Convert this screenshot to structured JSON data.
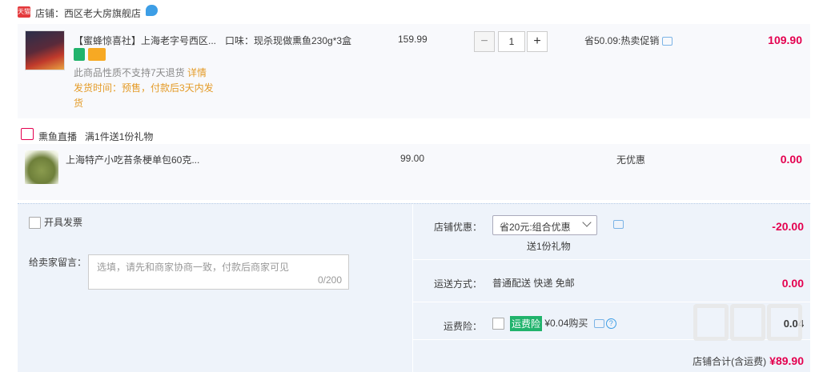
{
  "shop": {
    "badge": "天猫",
    "label": "店铺：",
    "name": "西区老大房旗舰店"
  },
  "item1": {
    "title": "【蜜蜂惊喜社】上海老字号西区...",
    "sku": "口味：现杀现做熏鱼230g*3盒",
    "note_prefix": "此商品性质不支持7天退货",
    "note_link": "详情",
    "ship_time": "发货时间：预售，付款后3天内发货",
    "price": "159.99",
    "qty": "1",
    "qty_minus": "−",
    "qty_plus": "+",
    "promo": "省50.09:热卖促销",
    "total": "109.90"
  },
  "gift": {
    "label": "熏鱼直播",
    "rule": "满1件送1份礼物"
  },
  "item2": {
    "title": "上海特产小吃苔条梗单包60克...",
    "price": "99.00",
    "promo": "无优惠",
    "total": "0.00"
  },
  "bottom": {
    "invoice_label": "开具发票",
    "msg_label": "给卖家留言：",
    "msg_placeholder": "选填，请先和商家协商一致，付款后商家可见",
    "msg_count": "0/200",
    "discount_label": "店铺优惠：",
    "discount_select": "省20元:组合优惠",
    "discount_gift": "送1份礼物",
    "discount_value": "-20.00",
    "ship_label": "运送方式：",
    "ship_value": "普通配送 快递 免邮",
    "ship_cost": "0.00",
    "ins_label": "运费险：",
    "ins_tag": "运费险",
    "ins_text": "¥0.04购买",
    "ins_value": "0.04",
    "total_label": "店铺合计(含运费)",
    "total_value": "¥89.90"
  }
}
